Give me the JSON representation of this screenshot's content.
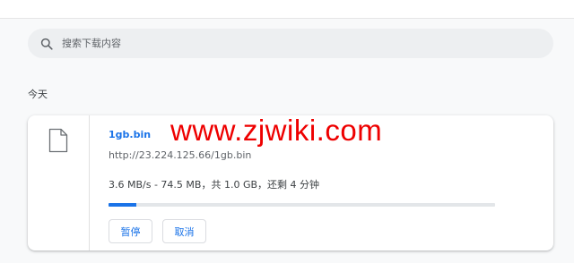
{
  "search": {
    "placeholder": "搜索下载内容",
    "icon": "search-icon"
  },
  "section": {
    "date_label": "今天"
  },
  "download": {
    "file_icon": "file-icon",
    "file_name": "1gb.bin",
    "url": "http://23.224.125.66/1gb.bin",
    "progress_text": "3.6 MB/s - 74.5 MB，共 1.0 GB，还剩 4 分钟",
    "progress_fraction": 0.0728,
    "pause_label": "暂停",
    "cancel_label": "取消"
  },
  "watermark": "www.zjwiki.com",
  "colors": {
    "accent": "#1a73e8",
    "watermark": "#ee0000",
    "background": "#f8f9fa"
  }
}
